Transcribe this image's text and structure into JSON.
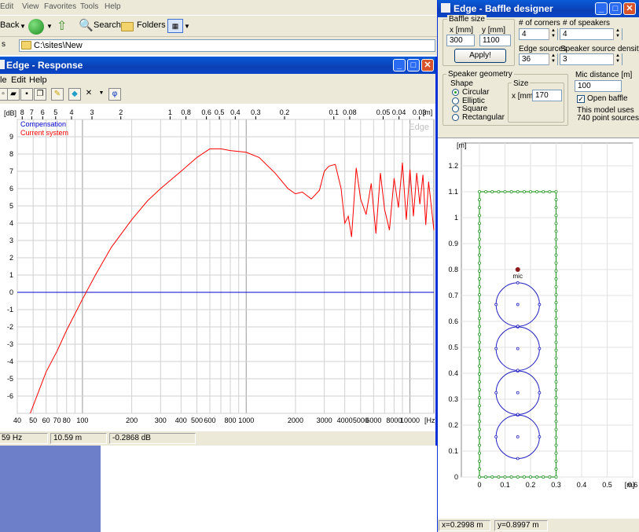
{
  "explorer": {
    "menu": [
      "Edit",
      "View",
      "Favorites",
      "Tools",
      "Help"
    ],
    "back_label": "Back",
    "search_label": "Search",
    "folders_label": "Folders",
    "address_label": "s",
    "address_path": "C:\\sites\\New"
  },
  "response": {
    "title": "Edge - Response",
    "menu": [
      "le",
      "Edit",
      "Help"
    ],
    "toolbar_phi": "φ",
    "status": [
      "59 Hz",
      "10.59 m",
      "-0.2868 dB"
    ]
  },
  "chart_data": {
    "type": "line",
    "title": "",
    "watermark": "Edge",
    "legend": [
      "Compensation",
      "Current system"
    ],
    "legend_placement": "top-left",
    "xlabel": "[Hz]",
    "ylabel": "[dB]",
    "x_scale": "log",
    "xlim": [
      40,
      14000
    ],
    "ylim": [
      -7,
      10
    ],
    "x_ticks": [
      "40",
      "50",
      "60",
      "70",
      "80",
      "100",
      "200",
      "300",
      "400",
      "500",
      "600",
      "800",
      "1000",
      "2000",
      "3000",
      "4000",
      "5000",
      "6000",
      "8000",
      "10000"
    ],
    "top_axis_label": "[m]",
    "top_ticks": [
      "8",
      "7",
      "6",
      "5",
      "4",
      "3",
      "2",
      "1",
      "0.8",
      "0.6",
      "0.5",
      "0.4",
      "0.3",
      "0.2",
      "0.1",
      "0.08",
      "0.05",
      "0.04",
      "0.03"
    ],
    "y_ticks": [
      "9",
      "8",
      "7",
      "6",
      "5",
      "4",
      "3",
      "2",
      "1",
      "0",
      "-1",
      "-2",
      "-3",
      "-4",
      "-5",
      "-6"
    ],
    "grid": true,
    "colors": {
      "compensation": "#0000cc",
      "current": "#ff0000"
    },
    "series": [
      {
        "name": "Compensation",
        "x": [
          40,
          14000
        ],
        "y": [
          0,
          0
        ]
      },
      {
        "name": "Current system",
        "x": [
          48,
          60,
          70,
          80,
          100,
          120,
          150,
          200,
          250,
          300,
          400,
          500,
          600,
          700,
          800,
          1000,
          1200,
          1500,
          1800,
          2000,
          2200,
          2500,
          2800,
          3000,
          3200,
          3500,
          3800,
          4000,
          4200,
          4400,
          4700,
          5000,
          5400,
          5800,
          6200,
          6600,
          7000,
          7500,
          8000,
          8500,
          9000,
          9500,
          10000,
          10500,
          11000,
          11500,
          12000,
          12500,
          13000,
          13500,
          14000
        ],
        "y": [
          -7,
          -4.6,
          -3.4,
          -2.2,
          -0.4,
          1.0,
          2.6,
          4.2,
          5.3,
          6.0,
          7.0,
          7.8,
          8.3,
          8.3,
          8.2,
          8.1,
          7.8,
          6.9,
          6.0,
          5.7,
          5.8,
          5.4,
          5.9,
          7.0,
          7.3,
          7.4,
          6.0,
          4.0,
          4.4,
          3.2,
          7.2,
          5.4,
          4.5,
          6.3,
          3.4,
          6.9,
          4.8,
          3.6,
          6.6,
          4.9,
          7.5,
          4.2,
          7.1,
          4.4,
          6.9,
          5.1,
          6.8,
          3.9,
          6.4,
          5.0,
          3.6
        ]
      }
    ]
  },
  "baffle": {
    "title": "Edge - Baffle designer",
    "baffle_size_label": "Baffle size",
    "x_label": "x [mm]",
    "y_label": "y [mm]",
    "x_value": "300",
    "y_value": "1100",
    "apply_label": "Apply!",
    "corners_label": "# of corners",
    "corners_value": "4",
    "speakers_label": "# of speakers",
    "speakers_value": "4",
    "edge_sources_label": "Edge sources",
    "edge_sources_value": "36",
    "density_label": "Speaker source density",
    "density_value": "3",
    "geometry_label": "Speaker geometry",
    "shape_label": "Shape",
    "shapes": [
      "Circular",
      "Elliptic",
      "Square",
      "Rectangular"
    ],
    "selected_shape": "Circular",
    "size_label": "Size",
    "size_unit": "x [mm]",
    "size_value": "170",
    "mic_label": "Mic distance [m]",
    "mic_value": "100",
    "open_baffle_label": "Open baffle",
    "model_note_1": "This model uses",
    "model_note_2": "740 point sources",
    "plot": {
      "y_unit": "[m]",
      "x_unit": "[m]",
      "y_ticks": [
        "1.2",
        "1.1",
        "1",
        "0.9",
        "0.8",
        "0.7",
        "0.6",
        "0.5",
        "0.4",
        "0.3",
        "0.2",
        "0.1",
        "0"
      ],
      "x_ticks": [
        "0",
        "0.1",
        "0.2",
        "0.3",
        "0.4",
        "0.5",
        "0.6"
      ],
      "mic_label": "mic",
      "baffle_width_m": 0.3,
      "baffle_height_m": 1.1,
      "speaker_diameter_m": 0.17,
      "speaker_centers_y_m": [
        0.155,
        0.325,
        0.495,
        0.665
      ],
      "speaker_center_x_m": 0.15,
      "mic_position_m": [
        0.15,
        0.8
      ]
    },
    "status": [
      "x=0.2998 m",
      "y=0.8997 m"
    ]
  }
}
